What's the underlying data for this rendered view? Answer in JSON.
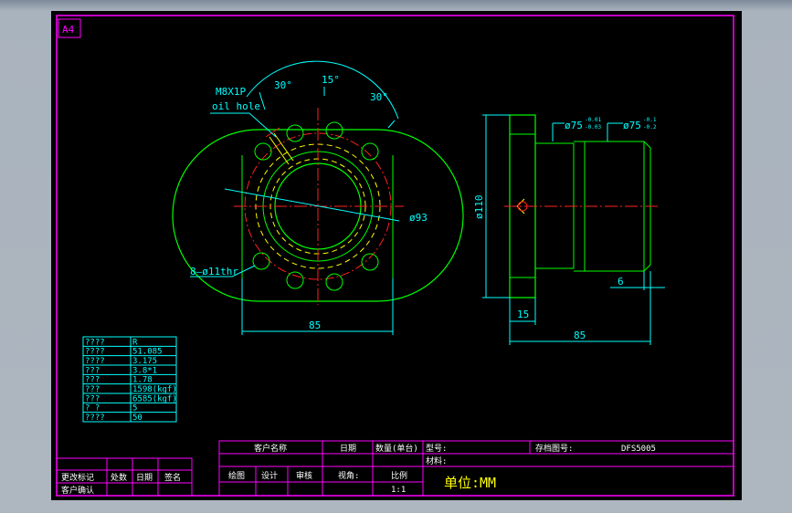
{
  "sheet": {
    "size_label": "A4"
  },
  "flange_view": {
    "thread_note_1": "M8X1P",
    "thread_note_2": "oil hole",
    "angle_left": "30°",
    "angle_mid": "15°",
    "angle_right": "30°",
    "pcd_label": "ø93",
    "holes_label": "8–ø11thr",
    "width_dim": "85"
  },
  "side_view": {
    "dia_small": "ø75",
    "dia_small_tol_upper": "-0.01",
    "dia_small_tol_lower": "-0.03",
    "dia_large": "ø75",
    "dia_large_tol_upper": "-0.1",
    "dia_large_tol_lower": "-0.2",
    "flange_dia": "ø110",
    "flange_width": "15",
    "total_length": "85",
    "end_length": "6"
  },
  "spec_table": {
    "rows": [
      {
        "name": "????",
        "value": "R"
      },
      {
        "name": "????",
        "value": "51.085"
      },
      {
        "name": "????",
        "value": "3.175"
      },
      {
        "name": "???",
        "value": "3.8*1"
      },
      {
        "name": "???",
        "value": "1.78"
      },
      {
        "name": "???",
        "value": "1598(kgf)"
      },
      {
        "name": "???",
        "value": "6585(kgf)"
      },
      {
        "name": "?  ?",
        "value": "5"
      },
      {
        "name": "????",
        "value": "50"
      }
    ]
  },
  "rev_block": {
    "row1": [
      "更改标记",
      "处数",
      "日期",
      "签名"
    ],
    "row2": [
      "客户确认"
    ]
  },
  "title_block": {
    "customer_name": "客户名称",
    "date": "日期",
    "qty": "数量(单台)",
    "model": "型号:",
    "drawing_no_label": "存档图号:",
    "drawing_no": "DFS5005",
    "material": "材料:",
    "draw": "绘图",
    "design": "设计",
    "review": "审核",
    "view": "视角:",
    "scale_label": "比例",
    "scale": "1:1",
    "unit": "单位:MM"
  },
  "colors": {
    "sheet": "#000000",
    "frame": "#ff00ff",
    "geometry": "#00ff00",
    "center": "#ff2020",
    "hidden": "#ffff00",
    "dim": "#00ffff",
    "text": "#ffffff"
  }
}
